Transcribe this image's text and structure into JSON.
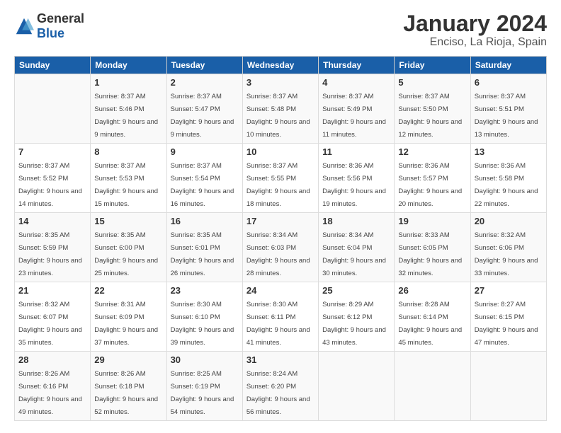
{
  "logo": {
    "general": "General",
    "blue": "Blue"
  },
  "title": "January 2024",
  "location": "Enciso, La Rioja, Spain",
  "days_of_week": [
    "Sunday",
    "Monday",
    "Tuesday",
    "Wednesday",
    "Thursday",
    "Friday",
    "Saturday"
  ],
  "weeks": [
    [
      {
        "num": "",
        "sunrise": "",
        "sunset": "",
        "daylight": ""
      },
      {
        "num": "1",
        "sunrise": "Sunrise: 8:37 AM",
        "sunset": "Sunset: 5:46 PM",
        "daylight": "Daylight: 9 hours and 9 minutes."
      },
      {
        "num": "2",
        "sunrise": "Sunrise: 8:37 AM",
        "sunset": "Sunset: 5:47 PM",
        "daylight": "Daylight: 9 hours and 9 minutes."
      },
      {
        "num": "3",
        "sunrise": "Sunrise: 8:37 AM",
        "sunset": "Sunset: 5:48 PM",
        "daylight": "Daylight: 9 hours and 10 minutes."
      },
      {
        "num": "4",
        "sunrise": "Sunrise: 8:37 AM",
        "sunset": "Sunset: 5:49 PM",
        "daylight": "Daylight: 9 hours and 11 minutes."
      },
      {
        "num": "5",
        "sunrise": "Sunrise: 8:37 AM",
        "sunset": "Sunset: 5:50 PM",
        "daylight": "Daylight: 9 hours and 12 minutes."
      },
      {
        "num": "6",
        "sunrise": "Sunrise: 8:37 AM",
        "sunset": "Sunset: 5:51 PM",
        "daylight": "Daylight: 9 hours and 13 minutes."
      }
    ],
    [
      {
        "num": "7",
        "sunrise": "Sunrise: 8:37 AM",
        "sunset": "Sunset: 5:52 PM",
        "daylight": "Daylight: 9 hours and 14 minutes."
      },
      {
        "num": "8",
        "sunrise": "Sunrise: 8:37 AM",
        "sunset": "Sunset: 5:53 PM",
        "daylight": "Daylight: 9 hours and 15 minutes."
      },
      {
        "num": "9",
        "sunrise": "Sunrise: 8:37 AM",
        "sunset": "Sunset: 5:54 PM",
        "daylight": "Daylight: 9 hours and 16 minutes."
      },
      {
        "num": "10",
        "sunrise": "Sunrise: 8:37 AM",
        "sunset": "Sunset: 5:55 PM",
        "daylight": "Daylight: 9 hours and 18 minutes."
      },
      {
        "num": "11",
        "sunrise": "Sunrise: 8:36 AM",
        "sunset": "Sunset: 5:56 PM",
        "daylight": "Daylight: 9 hours and 19 minutes."
      },
      {
        "num": "12",
        "sunrise": "Sunrise: 8:36 AM",
        "sunset": "Sunset: 5:57 PM",
        "daylight": "Daylight: 9 hours and 20 minutes."
      },
      {
        "num": "13",
        "sunrise": "Sunrise: 8:36 AM",
        "sunset": "Sunset: 5:58 PM",
        "daylight": "Daylight: 9 hours and 22 minutes."
      }
    ],
    [
      {
        "num": "14",
        "sunrise": "Sunrise: 8:35 AM",
        "sunset": "Sunset: 5:59 PM",
        "daylight": "Daylight: 9 hours and 23 minutes."
      },
      {
        "num": "15",
        "sunrise": "Sunrise: 8:35 AM",
        "sunset": "Sunset: 6:00 PM",
        "daylight": "Daylight: 9 hours and 25 minutes."
      },
      {
        "num": "16",
        "sunrise": "Sunrise: 8:35 AM",
        "sunset": "Sunset: 6:01 PM",
        "daylight": "Daylight: 9 hours and 26 minutes."
      },
      {
        "num": "17",
        "sunrise": "Sunrise: 8:34 AM",
        "sunset": "Sunset: 6:03 PM",
        "daylight": "Daylight: 9 hours and 28 minutes."
      },
      {
        "num": "18",
        "sunrise": "Sunrise: 8:34 AM",
        "sunset": "Sunset: 6:04 PM",
        "daylight": "Daylight: 9 hours and 30 minutes."
      },
      {
        "num": "19",
        "sunrise": "Sunrise: 8:33 AM",
        "sunset": "Sunset: 6:05 PM",
        "daylight": "Daylight: 9 hours and 32 minutes."
      },
      {
        "num": "20",
        "sunrise": "Sunrise: 8:32 AM",
        "sunset": "Sunset: 6:06 PM",
        "daylight": "Daylight: 9 hours and 33 minutes."
      }
    ],
    [
      {
        "num": "21",
        "sunrise": "Sunrise: 8:32 AM",
        "sunset": "Sunset: 6:07 PM",
        "daylight": "Daylight: 9 hours and 35 minutes."
      },
      {
        "num": "22",
        "sunrise": "Sunrise: 8:31 AM",
        "sunset": "Sunset: 6:09 PM",
        "daylight": "Daylight: 9 hours and 37 minutes."
      },
      {
        "num": "23",
        "sunrise": "Sunrise: 8:30 AM",
        "sunset": "Sunset: 6:10 PM",
        "daylight": "Daylight: 9 hours and 39 minutes."
      },
      {
        "num": "24",
        "sunrise": "Sunrise: 8:30 AM",
        "sunset": "Sunset: 6:11 PM",
        "daylight": "Daylight: 9 hours and 41 minutes."
      },
      {
        "num": "25",
        "sunrise": "Sunrise: 8:29 AM",
        "sunset": "Sunset: 6:12 PM",
        "daylight": "Daylight: 9 hours and 43 minutes."
      },
      {
        "num": "26",
        "sunrise": "Sunrise: 8:28 AM",
        "sunset": "Sunset: 6:14 PM",
        "daylight": "Daylight: 9 hours and 45 minutes."
      },
      {
        "num": "27",
        "sunrise": "Sunrise: 8:27 AM",
        "sunset": "Sunset: 6:15 PM",
        "daylight": "Daylight: 9 hours and 47 minutes."
      }
    ],
    [
      {
        "num": "28",
        "sunrise": "Sunrise: 8:26 AM",
        "sunset": "Sunset: 6:16 PM",
        "daylight": "Daylight: 9 hours and 49 minutes."
      },
      {
        "num": "29",
        "sunrise": "Sunrise: 8:26 AM",
        "sunset": "Sunset: 6:18 PM",
        "daylight": "Daylight: 9 hours and 52 minutes."
      },
      {
        "num": "30",
        "sunrise": "Sunrise: 8:25 AM",
        "sunset": "Sunset: 6:19 PM",
        "daylight": "Daylight: 9 hours and 54 minutes."
      },
      {
        "num": "31",
        "sunrise": "Sunrise: 8:24 AM",
        "sunset": "Sunset: 6:20 PM",
        "daylight": "Daylight: 9 hours and 56 minutes."
      },
      {
        "num": "",
        "sunrise": "",
        "sunset": "",
        "daylight": ""
      },
      {
        "num": "",
        "sunrise": "",
        "sunset": "",
        "daylight": ""
      },
      {
        "num": "",
        "sunrise": "",
        "sunset": "",
        "daylight": ""
      }
    ]
  ]
}
